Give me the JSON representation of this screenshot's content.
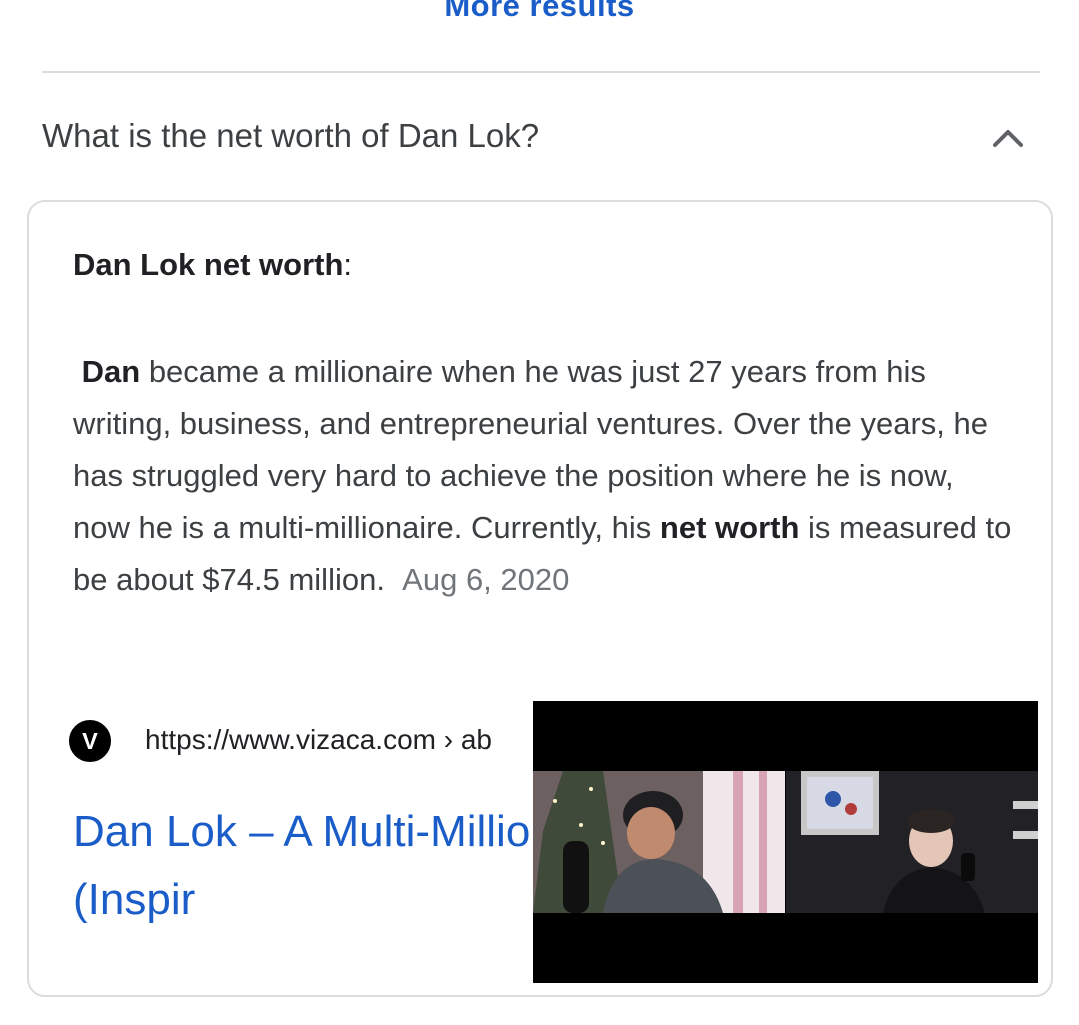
{
  "more_results": "More results",
  "faq": {
    "question": "What is the net worth of Dan Lok?",
    "toggle_icon": "chevron-up-icon"
  },
  "answer": {
    "heading_bold": "Dan Lok net worth",
    "heading_suffix": ":",
    "snippet_parts": {
      "p1_bold": "Dan",
      "p2": " became a millionaire when he was just 27 years from his writing, business, and entrepreneurial ventures. Over the years, he has struggled very hard to achieve the position where he is now, now he is a multi-millionaire. Currently, his ",
      "p3_bold": "net worth",
      "p4": " is measured to be about $74.5 million.",
      "date": "Aug 6, 2020"
    },
    "source": {
      "logo_letter": "V",
      "url": "https://www.vizaca.com › ab"
    },
    "result_title": "Dan Lok – A Multi-Millionaire Businessmen (Inspir"
  },
  "colors": {
    "link": "#1a5dc8",
    "text": "#202124",
    "secondary": "#70757a",
    "border": "#dadce0"
  },
  "video_overlay": {
    "icon": "video-thumbnail-icon"
  }
}
